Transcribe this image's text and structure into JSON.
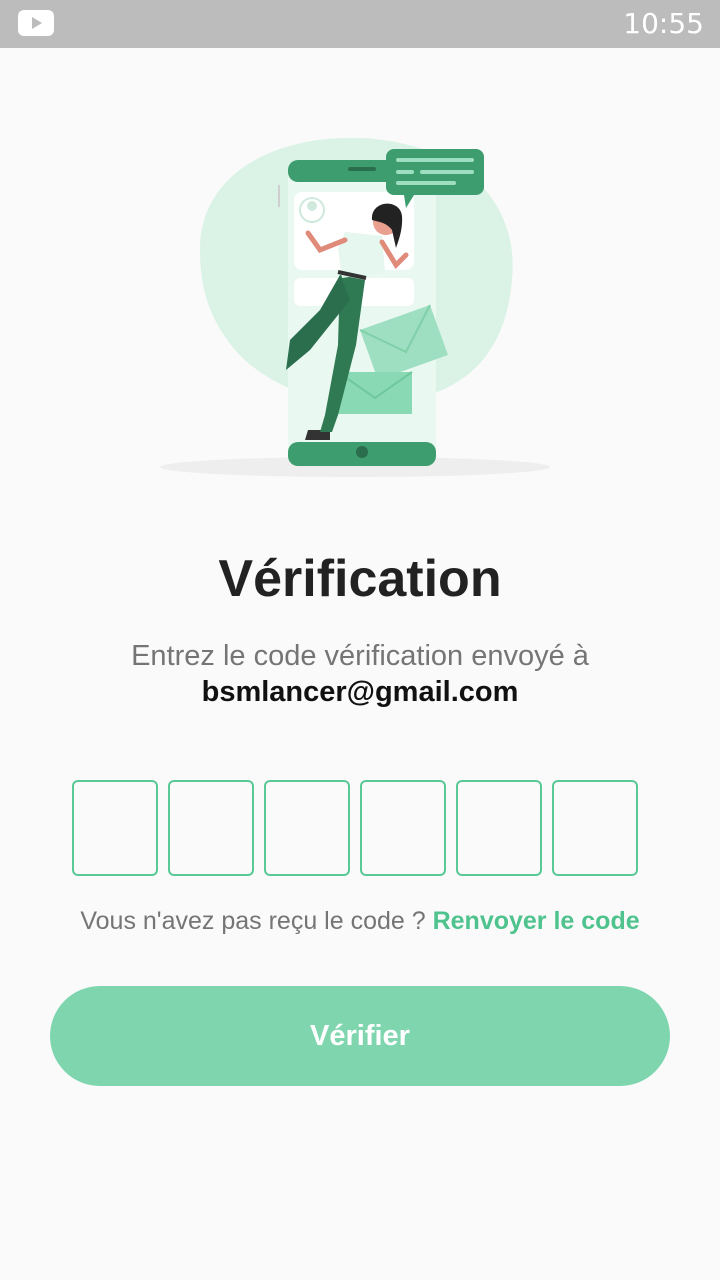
{
  "status_bar": {
    "app_icon": "youtube-icon",
    "time": "10:55"
  },
  "illustration": {
    "icon": "phone-verification-illustration"
  },
  "page": {
    "title": "Vérification",
    "subtitle": "Entrez le code vérification envoyé à",
    "email": "bsmlancer@gmail.com"
  },
  "code_inputs": [
    "",
    "",
    "",
    "",
    "",
    ""
  ],
  "resend": {
    "question": "Vous n'avez pas reçu le code ? ",
    "link_label": "Renvoyer le code"
  },
  "verify_button": {
    "label": "Vérifier"
  },
  "colors": {
    "accent": "#4fc38d",
    "button": "#7fd6ae",
    "box_border": "#5bc995",
    "status_bar": "#bcbcbc"
  }
}
